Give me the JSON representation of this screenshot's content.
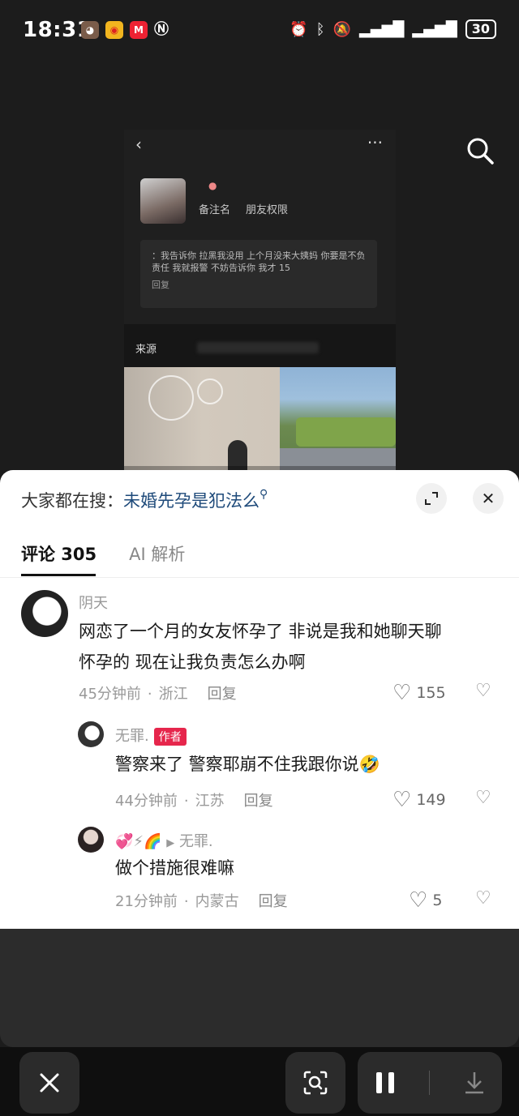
{
  "status_bar": {
    "time": "18:31",
    "battery": "30",
    "app_icons": [
      "avatar-icon",
      "weibo-icon",
      "meituan-icon",
      "nfc-icon"
    ],
    "right_icons": [
      "alarm-icon",
      "bluetooth-icon",
      "mute-icon",
      "signal-icon",
      "signal-icon"
    ]
  },
  "video": {
    "note_label": "备注名",
    "permission_label": "朋友权限",
    "message": "：我告诉你 拉黑我没用 上个月没来大姨妈 你要是不负责任 我就报警 不妨告诉你 我才 15",
    "reply_label": "回复",
    "source_label": "来源"
  },
  "sheet": {
    "search_prefix": "大家都在搜：",
    "search_query": "未婚先孕是犯法么",
    "tabs": [
      {
        "label": "评论 305",
        "active": true
      },
      {
        "label": "AI 解析",
        "active": false
      }
    ]
  },
  "comments": [
    {
      "name": "阴天",
      "content_line1": "网恋了一个月的女友怀孕了 非说是我和她聊天聊",
      "content_line2": "怀孕的 现在让我负责怎么办啊",
      "time": "45分钟前",
      "location": "浙江",
      "reply": "回复",
      "likes": "155"
    },
    {
      "name": "无罪.",
      "author_tag": "作者",
      "content": "警察来了 警察耶崩不住我跟你说🤣",
      "time": "44分钟前",
      "location": "江苏",
      "reply": "回复",
      "likes": "149"
    },
    {
      "name_prefix": "💞⚡🌈",
      "reply_to": "无罪.",
      "content": "做个措施很难嘛",
      "time": "21分钟前",
      "location": "内蒙古",
      "reply": "回复",
      "likes": "5"
    }
  ],
  "colors": {
    "accent_blue": "#1e4a7a",
    "author_red": "#e6264c",
    "background": "#1c1c1c"
  }
}
